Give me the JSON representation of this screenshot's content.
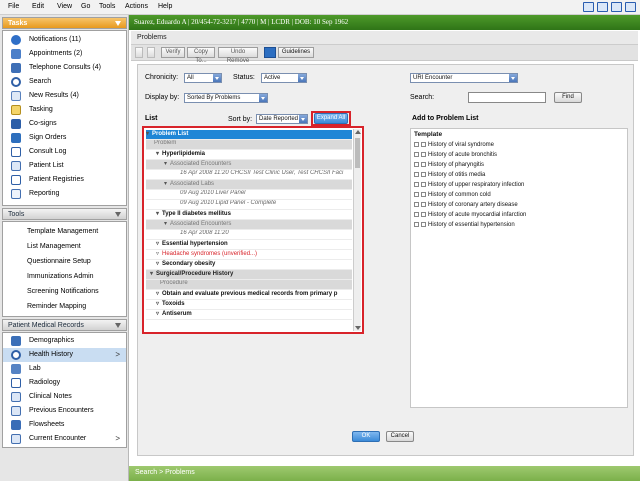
{
  "menubar": {
    "items": [
      "File",
      "Edit",
      "View",
      "Go",
      "Tools",
      "Actions",
      "Help"
    ]
  },
  "left": {
    "tasks": {
      "title": "Tasks",
      "items": [
        {
          "label": "Notifications (11)",
          "icon": "alert-icon"
        },
        {
          "label": "Appointments (2)",
          "icon": "calendar-icon"
        },
        {
          "label": "Telephone Consults (4)",
          "icon": "telephone-icon"
        },
        {
          "label": "Search",
          "icon": "search-icon"
        },
        {
          "label": "New Results (4)",
          "icon": "results-icon"
        },
        {
          "label": "Tasking",
          "icon": "tasking-icon"
        },
        {
          "label": "Co-signs",
          "icon": "cosign-icon"
        },
        {
          "label": "Sign Orders",
          "icon": "sign-orders-icon"
        },
        {
          "label": "Consult Log",
          "icon": "consult-log-icon"
        },
        {
          "label": "Patient List",
          "icon": "patient-list-icon"
        },
        {
          "label": "Patient Registries",
          "icon": "registries-icon"
        },
        {
          "label": "Reporting",
          "icon": "reporting-icon"
        }
      ]
    },
    "tools": {
      "title": "Tools",
      "items": [
        "Template Management",
        "List Management",
        "Questionnaire Setup",
        "Immunizations Admin",
        "Screening Notifications",
        "Reminder Mapping"
      ]
    },
    "records": {
      "title": "Patient Medical Records",
      "items": [
        {
          "label": "Demographics",
          "icon": "demographics-icon"
        },
        {
          "label": "Health History",
          "icon": "health-history-icon",
          "chev": ">"
        },
        {
          "label": "Lab",
          "icon": "lab-icon"
        },
        {
          "label": "Radiology",
          "icon": "radiology-icon"
        },
        {
          "label": "Clinical Notes",
          "icon": "clinical-notes-icon"
        },
        {
          "label": "Previous Encounters",
          "icon": "encounters-icon"
        },
        {
          "label": "Flowsheets",
          "icon": "flowsheets-icon"
        },
        {
          "label": "Current Encounter",
          "icon": "current-encounter-icon",
          "chev": ">"
        }
      ]
    }
  },
  "patient": {
    "banner": "Suarez, Eduardo A | 20/454-72-3217 | 4770 | M | LCDR | DOB: 10 Sep 1962"
  },
  "page": {
    "title": "Problems"
  },
  "toolbar": {
    "verify": "Verify",
    "copy_to": "Copy To...",
    "undo_remove": "Undo Remove",
    "guidelines": "Guidelines"
  },
  "filters": {
    "chronicity_label": "Chronicity:",
    "chronicity_value": "All",
    "status_label": "Status:",
    "status_value": "Active",
    "display_by_label": "Display by:",
    "display_by_value": "Sorted By Problems",
    "encounter_value": "URI Encounter",
    "search_label": "Search:",
    "search_value": "",
    "find_label": "Find"
  },
  "list": {
    "title": "List",
    "sort_label": "Sort by:",
    "sort_value": "Date Reported",
    "expand_label": "Expand All",
    "rows": [
      {
        "text": "Problem List",
        "tw": "▾"
      },
      {
        "text": "Problem",
        "tw": ""
      },
      {
        "text": "Hyperlipidemia",
        "tw": "▾"
      },
      {
        "text": "Associated Encounters",
        "tw": "▾"
      },
      {
        "text": "16 Apr 2008 11:20   CHCSII Test Clinic User, Test CHCSII Faci",
        "tw": ""
      },
      {
        "text": "Associated Labs",
        "tw": "▾"
      },
      {
        "text": "09 Aug 2010   Liver Panel",
        "tw": ""
      },
      {
        "text": "09 Aug 2010   Lipid Panel - Complete",
        "tw": ""
      },
      {
        "text": "Type II diabetes mellitus",
        "tw": "▾"
      },
      {
        "text": "Associated Encounters",
        "tw": "▾"
      },
      {
        "text": "16 Apr 2008 11:20",
        "tw": ""
      },
      {
        "text": "Essential hypertension",
        "tw": "▿"
      },
      {
        "text": "Headache syndromes (unverified...)",
        "tw": "▿"
      },
      {
        "text": "Secondary obesity",
        "tw": "▿"
      },
      {
        "text": "Surgical/Procedure History",
        "tw": "▾"
      },
      {
        "text": "Procedure",
        "tw": ""
      },
      {
        "text": "Obtain and evaluate previous medical records from primary p",
        "tw": "▿"
      },
      {
        "text": "Toxoids",
        "tw": "▿"
      },
      {
        "text": "Antiserum",
        "tw": "▿"
      }
    ]
  },
  "add": {
    "title": "Add to Problem List",
    "template_label": "Template",
    "items": [
      "History of viral syndrome",
      "History of acute bronchitis",
      "History of pharyngitis",
      "History of otitis media",
      "History of upper respiratory infection",
      "History of common cold",
      "History of coronary artery disease",
      "History of acute myocardial infarction",
      "History of essential hypertension"
    ]
  },
  "actions": {
    "ok": "OK",
    "cancel": "Cancel"
  },
  "footer": {
    "breadcrumb": "Search > Problems"
  },
  "colors": {
    "accent_green": "#2f7417",
    "highlight_red": "#d8232a",
    "list_header_blue": "#1f86d6",
    "tasks_orange": "#e79a1e"
  }
}
